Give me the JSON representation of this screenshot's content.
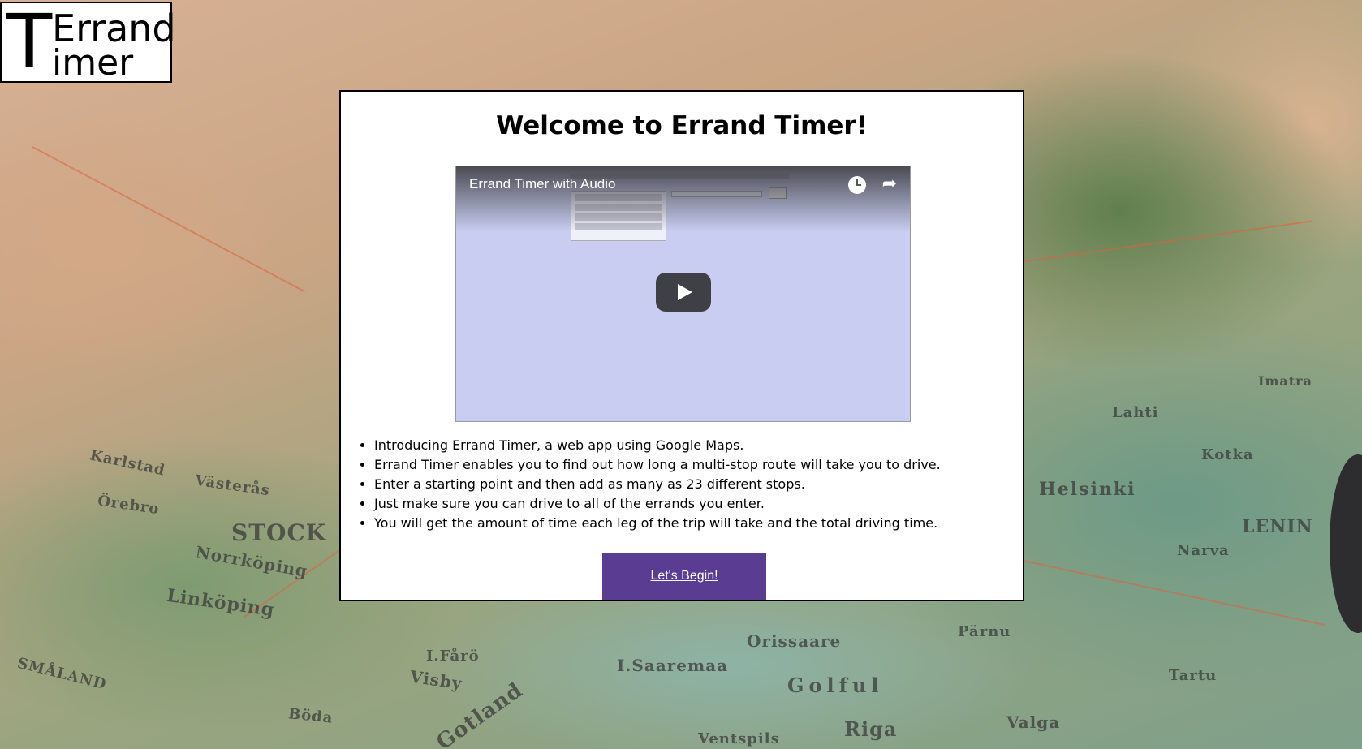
{
  "logo": {
    "letter_t": "T",
    "line1": "Errand",
    "line2": "imer"
  },
  "map_labels": [
    "Karlstad",
    "Västerås",
    "Örebro",
    "STOCK",
    "Norrköping",
    "Linköping",
    "SMÅLAND",
    "Böda",
    "Visby",
    "I.Fårö",
    "Gotland",
    "I.Saaremaa",
    "Orissaare",
    "Golful",
    "Riga",
    "Ventspils",
    "Valga",
    "Tartu",
    "Narva",
    "Pärnu",
    "Helsinki",
    "Lahti",
    "Kotka",
    "LENIN",
    "Imatra"
  ],
  "panel": {
    "title": "Welcome to Errand Timer!",
    "video": {
      "title": "Errand Timer with Audio",
      "share_glyph": "➦"
    },
    "bullets": [
      "Introducing Errand Timer, a web app using Google Maps.",
      "Errand Timer enables you to find out how long a multi-stop route will take you to drive.",
      "Enter a starting point and then add as many as 23 different stops.",
      "Just make sure you can drive to all of the errands you enter.",
      "You will get the amount of time each leg of the trip will take and the total driving time."
    ],
    "cta_label": "Let's Begin!"
  },
  "colors": {
    "cta_bg": "#5a3c92",
    "video_bg": "#c8cdf1"
  }
}
